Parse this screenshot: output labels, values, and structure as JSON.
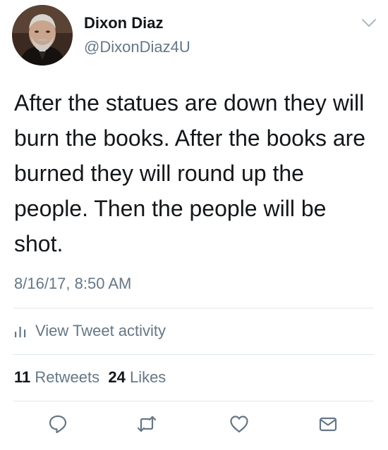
{
  "tweet": {
    "author": {
      "display_name": "Dixon Diaz",
      "handle": "@DixonDiaz4U",
      "avatar": "profile-photo"
    },
    "text": "After the statues are down they will burn the books. After the books are burned they will round up the people. Then the people will be shot.",
    "timestamp": "8/16/17, 8:50 AM",
    "activity_label": "View Tweet activity",
    "stats": {
      "retweets_count": "11",
      "retweets_label": "Retweets",
      "likes_count": "24",
      "likes_label": "Likes"
    },
    "icons": {
      "menu": "chevron-down-icon",
      "activity": "bar-chart-icon",
      "reply": "reply-icon",
      "retweet": "retweet-icon",
      "like": "heart-icon",
      "message": "envelope-icon"
    }
  },
  "colors": {
    "text_primary": "#14171a",
    "text_secondary": "#657786",
    "divider": "#e1e8ed"
  }
}
